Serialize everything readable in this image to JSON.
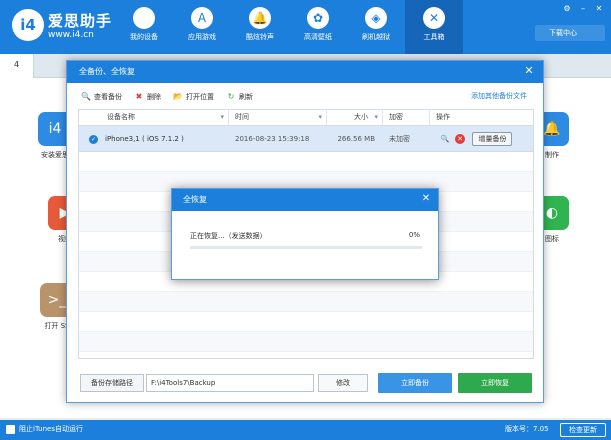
{
  "app": {
    "brand": "爱思助手",
    "site": "www.i4.cn",
    "logo_text": "i4"
  },
  "nav": [
    {
      "label": "我的设备",
      "icon": "apple-icon",
      "glyph": ""
    },
    {
      "label": "应用游戏",
      "icon": "app-store-icon",
      "glyph": "A"
    },
    {
      "label": "酷炫铃声",
      "icon": "bell-icon",
      "glyph": "🔔"
    },
    {
      "label": "高清壁纸",
      "icon": "flower-icon",
      "glyph": "✿"
    },
    {
      "label": "刷机越狱",
      "icon": "box-icon",
      "glyph": "◈"
    },
    {
      "label": "工具箱",
      "icon": "tools-icon",
      "glyph": "✕"
    }
  ],
  "download_manager": "下载中心",
  "tabs": {
    "current": "4"
  },
  "tools": [
    {
      "label": "安装爱思",
      "color": "#2d8be3",
      "glyph": "i4"
    },
    {
      "label": "视频",
      "color": "#e65a3a",
      "glyph": "▶"
    },
    {
      "label": "打开 SS",
      "color": "#b9946b",
      "glyph": ">_"
    },
    {
      "label": "制作",
      "color": "#2d8be3",
      "glyph": "🔔"
    },
    {
      "label": "图标",
      "color": "#2fb44f",
      "glyph": "◐"
    }
  ],
  "statusbar": {
    "itunes": "阻止iTunes自动运行",
    "version": "版本号：7.05",
    "check_update": "检查更新"
  },
  "backup_dialog": {
    "title": "全备份、全恢复",
    "toolbar": [
      {
        "label": "查看备份",
        "icon": "search-icon",
        "glyph": "🔍"
      },
      {
        "label": "删除",
        "icon": "delete-icon",
        "glyph": "✖"
      },
      {
        "label": "打开位置",
        "icon": "folder-icon",
        "glyph": "📂"
      },
      {
        "label": "刷新",
        "icon": "refresh-icon",
        "glyph": "↻"
      }
    ],
    "add_link": "添加其他备份文件",
    "columns": [
      "设备名称",
      "时间",
      "大小",
      "加密",
      "操作"
    ],
    "rows": [
      {
        "device": "iPhone3,1 ( iOS 7.1.2 )",
        "time": "2016-08-23 15:39:18",
        "size": "266.56 MB",
        "encrypted": "未加密",
        "action": "增量备份"
      }
    ],
    "path_label": "备份存储路径",
    "path_value": "F:\\i4Tools7\\Backup",
    "modify": "修改",
    "backup_now": "立即备份",
    "restore_now": "立即恢复"
  },
  "progress_dialog": {
    "title": "全恢复",
    "status": "正在恢复...（发送数据）",
    "percent_text": "0%",
    "progress": 0
  },
  "colors": {
    "primary": "#1d7fdc",
    "green": "#2fa94d"
  }
}
